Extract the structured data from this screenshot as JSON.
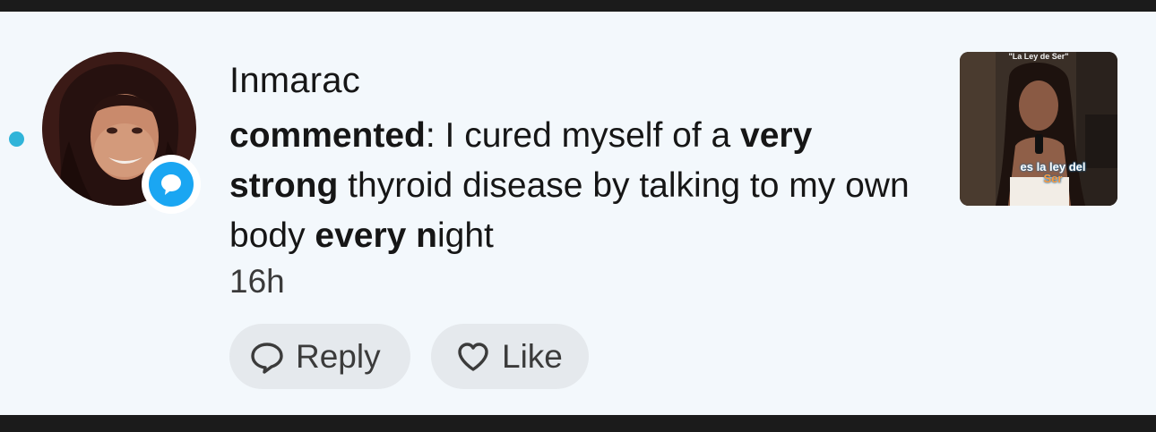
{
  "notification": {
    "username": "Inmarac",
    "comment_parts": [
      {
        "text": "commented",
        "bold": true
      },
      {
        "text": ": I cured myself of a ",
        "bold": false
      },
      {
        "text": "very strong",
        "bold": true
      },
      {
        "text": " thyroid disease by talking to my own body ",
        "bold": false
      },
      {
        "text": "every n",
        "bold": true
      },
      {
        "text": "ight",
        "bold": false
      }
    ],
    "time": "16h",
    "unread": true
  },
  "actions": {
    "reply_label": "Reply",
    "like_label": "Like"
  },
  "thumbnail": {
    "top_text": "\"La Ley de Ser\"",
    "caption_line1": "es la ley del",
    "caption_line2": "Ser"
  },
  "icons": {
    "badge": "comment-bubble-icon",
    "reply": "speech-bubble-icon",
    "like": "heart-outline-icon"
  },
  "colors": {
    "background": "#f3f8fc",
    "unread_dot": "#30b4d9",
    "badge_blue": "#1aa6f2",
    "pill_background": "#e5e9ed",
    "text": "#161616"
  }
}
